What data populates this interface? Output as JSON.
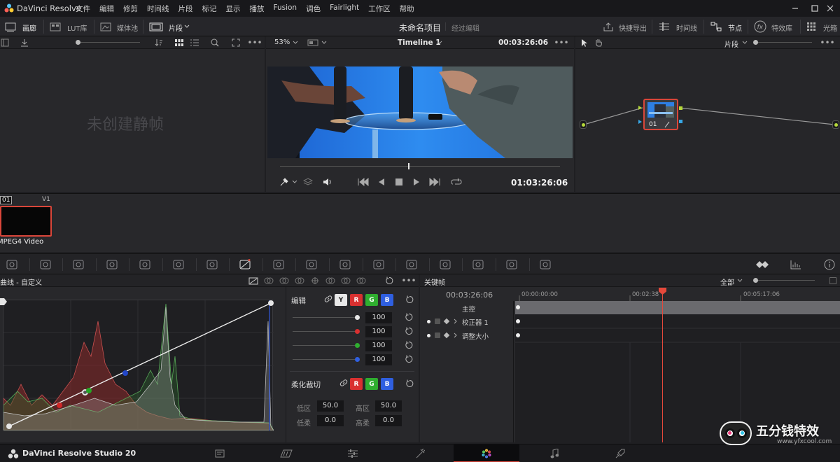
{
  "menubar": {
    "app_name": "DaVinci Resolve",
    "menus": [
      "文件",
      "编辑",
      "修剪",
      "时间线",
      "片段",
      "标记",
      "显示",
      "播放",
      "Fusion",
      "调色",
      "Fairlight",
      "工作区",
      "帮助"
    ]
  },
  "toolbar": {
    "gallery": "画廊",
    "lut": "LUT库",
    "media_pool": "媒体池",
    "clips": "片段",
    "project_title": "未命名项目",
    "project_status": "经过编辑",
    "quick_export": "快捷导出",
    "timeline": "时间线",
    "nodes": "节点",
    "effects": "特效库",
    "lightbox": "光箱"
  },
  "viewer": {
    "zoom": "53%",
    "timeline_name": "Timeline 1",
    "timecode_top": "00:03:26:06",
    "timecode_bottom": "01:03:26:06",
    "progress": 0.46
  },
  "gallery": {
    "empty_text": "未创建静帧"
  },
  "node_editor": {
    "mode": "片段",
    "node_label": "01"
  },
  "clip_strip": {
    "clip_number": "01",
    "track": "V1",
    "codec": "MPEG4 Video"
  },
  "curves": {
    "title": "曲线 - 自定义",
    "edit_label": "编辑",
    "channels": [
      "Y",
      "R",
      "G",
      "B"
    ],
    "channel_colors": [
      "#e8e8e8",
      "#d93030",
      "#2fae2f",
      "#2f5fe0"
    ],
    "intensity": [
      "100",
      "100",
      "100",
      "100"
    ],
    "soft_clip_label": "柔化裁切",
    "soft_channels": [
      "R",
      "G",
      "B"
    ],
    "low_label": "低区",
    "low_value": "50.0",
    "high_label": "高区",
    "high_value": "50.0",
    "low_soft_label": "低柔",
    "low_soft_value": "0.0",
    "high_soft_label": "高柔",
    "high_soft_value": "0.0"
  },
  "keyframes": {
    "title": "关键帧",
    "filter": "全部",
    "timecode": "00:03:26:06",
    "ruler": [
      "00:00:00:00",
      "00:02:38",
      "00:05:17:06"
    ],
    "tracks": [
      "主控",
      "校正器 1",
      "调整大小"
    ]
  },
  "bottom_bar": {
    "app_label": "DaVinci Resolve Studio 20",
    "watermark_title": "五分钱特效",
    "watermark_url": "www.yfxcool.com"
  }
}
